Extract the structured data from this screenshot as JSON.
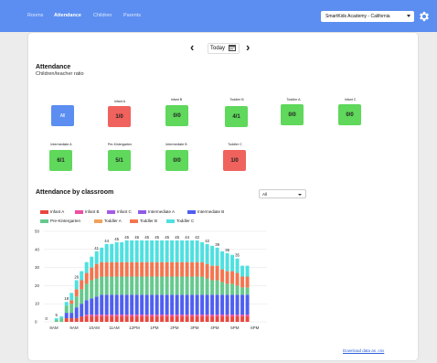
{
  "nav": {
    "items": [
      {
        "label": "Rooms",
        "active": false
      },
      {
        "label": "Attendance",
        "active": true
      },
      {
        "label": "Children",
        "active": false
      },
      {
        "label": "Parents",
        "active": false
      }
    ],
    "school_select": "SmartKids Academy - California"
  },
  "date_nav": {
    "label": "Today",
    "prev": "‹",
    "next": "›"
  },
  "attendance": {
    "title": "Attendance",
    "subtitle": "Children/teacher ratio",
    "rooms": [
      {
        "name": "",
        "value": "All",
        "status": "all"
      },
      {
        "name": "Infant A",
        "value": "1/0",
        "status": "red"
      },
      {
        "name": "Infant B",
        "value": "0/0",
        "status": "green"
      },
      {
        "name": "Toddler B",
        "value": "4/1",
        "status": "green"
      },
      {
        "name": "Toddler A",
        "value": "0/0",
        "status": "green"
      },
      {
        "name": "Infant C",
        "value": "0/0",
        "status": "green"
      },
      {
        "name": "Intermediate A",
        "value": "6/1",
        "status": "green"
      },
      {
        "name": "Pre-Kintergarten",
        "value": "5/1",
        "status": "green"
      },
      {
        "name": "Intermediate B",
        "value": "0/0",
        "status": "green"
      },
      {
        "name": "Toddler C",
        "value": "1/0",
        "status": "red"
      }
    ]
  },
  "by_classroom": {
    "title": "Attendance by classroom",
    "filter_value": "All"
  },
  "colors": {
    "Infant A": "#e8473f",
    "Infant B": "#ee4fa0",
    "Infant C": "#a35ce6",
    "Intermediate A": "#8e5be8",
    "Intermediate B": "#4f5ff0",
    "Pre-Kintergarten": "#66c98e",
    "Toddler A": "#f0a25c",
    "Toddler B": "#f27650",
    "Toddler C": "#4fe0e0",
    "nav_bg": "#5b8ef0",
    "tile_green": "#5fd85b",
    "tile_red": "#f0625d"
  },
  "chart_data": {
    "type": "bar",
    "stacked": true,
    "x_tick_labels": [
      "8AM",
      "9AM",
      "10AM",
      "11AM",
      "12PM",
      "1PM",
      "2PM",
      "3PM",
      "4PM",
      "5PM",
      "6PM"
    ],
    "x_start_hour": 7.5,
    "bar_interval_hours": 0.25,
    "ylim": [
      0,
      50
    ],
    "y_ticks": [
      0,
      10,
      20,
      30,
      40,
      50
    ],
    "legend": [
      "Infant A",
      "Infant B",
      "Infant C",
      "Intermediate A",
      "Intermediate B",
      "Pre-Kintergarten",
      "Toddler A",
      "Toddler B",
      "Toddler C"
    ],
    "series": [
      {
        "name": "Infant A",
        "values": [
          0,
          0,
          0,
          0,
          2,
          2,
          2,
          3,
          3,
          3,
          3,
          3,
          3,
          3,
          3,
          3,
          3,
          3,
          3,
          3,
          3,
          3,
          3,
          3,
          3,
          3,
          3,
          3,
          3,
          3,
          3,
          3,
          3,
          3,
          3,
          3,
          3,
          3,
          3,
          3,
          3
        ]
      },
      {
        "name": "Infant B",
        "values": [
          0,
          0,
          0,
          0,
          0,
          0,
          0,
          0,
          1,
          1,
          1,
          1,
          1,
          1,
          1,
          1,
          1,
          1,
          1,
          1,
          1,
          1,
          1,
          1,
          1,
          1,
          1,
          1,
          1,
          1,
          1,
          1,
          1,
          1,
          1,
          1,
          1,
          1,
          1,
          1,
          1
        ]
      },
      {
        "name": "Infant C",
        "values": [
          0,
          0,
          0,
          0,
          0,
          0,
          0,
          0,
          0,
          0,
          0,
          0,
          0,
          0,
          0,
          0,
          0,
          0,
          0,
          0,
          0,
          0,
          0,
          0,
          0,
          0,
          0,
          0,
          0,
          0,
          0,
          0,
          0,
          0,
          0,
          0,
          0,
          0,
          0,
          0,
          0
        ]
      },
      {
        "name": "Intermediate A",
        "values": [
          0,
          0,
          0,
          0,
          0,
          0,
          0,
          0,
          0,
          0,
          0,
          0,
          0,
          0,
          0,
          0,
          0,
          0,
          0,
          0,
          0,
          0,
          0,
          0,
          0,
          0,
          0,
          0,
          0,
          0,
          0,
          0,
          0,
          0,
          0,
          0,
          0,
          0,
          0,
          0,
          0
        ]
      },
      {
        "name": "Intermediate B",
        "values": [
          0,
          0,
          0,
          0,
          3,
          3,
          6,
          7,
          8,
          9,
          10,
          11,
          11,
          11,
          11,
          11,
          11,
          11,
          11,
          11,
          11,
          11,
          11,
          11,
          11,
          11,
          11,
          11,
          11,
          11,
          11,
          11,
          11,
          11,
          11,
          11,
          11,
          11,
          11,
          11,
          11
        ]
      },
      {
        "name": "Pre-Kintergarten",
        "values": [
          0,
          0,
          1,
          2,
          4,
          5,
          6,
          8,
          9,
          10,
          10,
          10,
          10,
          10,
          10,
          10,
          10,
          10,
          10,
          10,
          10,
          10,
          10,
          10,
          10,
          10,
          10,
          10,
          10,
          10,
          10,
          10,
          9,
          8,
          8,
          7,
          6,
          6,
          5,
          4,
          4
        ]
      },
      {
        "name": "Toddler A",
        "values": [
          0,
          0,
          0,
          0,
          0,
          0,
          0,
          0,
          0,
          0,
          0,
          0,
          0,
          0,
          0,
          0,
          0,
          0,
          0,
          0,
          0,
          0,
          0,
          0,
          0,
          0,
          0,
          0,
          0,
          0,
          0,
          0,
          0,
          0,
          0,
          0,
          0,
          0,
          0,
          0,
          0
        ]
      },
      {
        "name": "Toddler B",
        "values": [
          0,
          0,
          0,
          0,
          0,
          2,
          4,
          5,
          6,
          7,
          8,
          8,
          8,
          8,
          8,
          8,
          8,
          8,
          8,
          8,
          8,
          8,
          8,
          8,
          8,
          8,
          8,
          8,
          8,
          8,
          8,
          8,
          8,
          8,
          8,
          7,
          7,
          7,
          7,
          6,
          6
        ]
      },
      {
        "name": "Toddler C",
        "values": [
          0,
          0,
          1,
          1,
          2,
          4,
          5,
          5,
          6,
          6,
          7,
          8,
          10,
          10,
          11,
          11,
          12,
          12,
          12,
          12,
          12,
          12,
          12,
          12,
          12,
          12,
          12,
          12,
          12,
          12,
          12,
          11,
          11,
          11,
          10,
          10,
          10,
          9,
          8,
          6,
          6
        ]
      }
    ],
    "data_labels": [
      {
        "index": 0,
        "text": "0"
      },
      {
        "index": 2,
        "text": "5"
      },
      {
        "index": 4,
        "text": "19"
      },
      {
        "index": 6,
        "text": "26"
      },
      {
        "index": 10,
        "text": "41"
      },
      {
        "index": 12,
        "text": "44"
      },
      {
        "index": 14,
        "text": "45"
      },
      {
        "index": 16,
        "text": "45"
      },
      {
        "index": 18,
        "text": "45"
      },
      {
        "index": 20,
        "text": "45"
      },
      {
        "index": 22,
        "text": "45"
      },
      {
        "index": 24,
        "text": "45"
      },
      {
        "index": 26,
        "text": "45"
      },
      {
        "index": 28,
        "text": "44"
      },
      {
        "index": 30,
        "text": "42"
      },
      {
        "index": 32,
        "text": "42"
      },
      {
        "index": 34,
        "text": "39"
      },
      {
        "index": 36,
        "text": "36"
      },
      {
        "index": 38,
        "text": "35"
      }
    ]
  },
  "download_label": "Download data as .csv"
}
